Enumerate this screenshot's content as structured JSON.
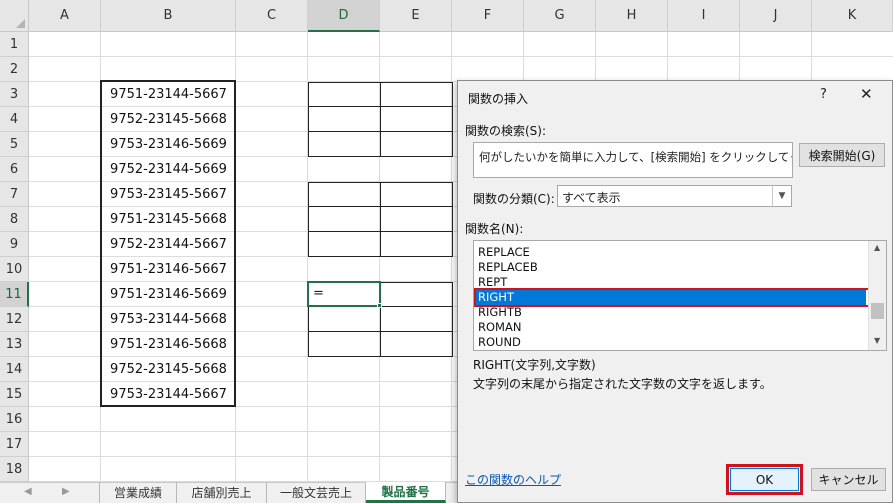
{
  "sheet": {
    "columns": [
      "A",
      "B",
      "C",
      "D",
      "E",
      "F",
      "G",
      "H",
      "I",
      "J",
      "K"
    ],
    "rows": [
      "1",
      "2",
      "3",
      "4",
      "5",
      "6",
      "7",
      "8",
      "9",
      "10",
      "11",
      "12",
      "13",
      "14",
      "15",
      "16",
      "17",
      "18"
    ],
    "selected_column": "D",
    "selected_row": "11",
    "b_values": [
      "9751-23144-5667",
      "9752-23145-5668",
      "9753-23146-5669",
      "9752-23144-5669",
      "9753-23145-5667",
      "9751-23145-5668",
      "9752-23144-5667",
      "9751-23146-5667",
      "9751-23146-5669",
      "9753-23144-5668",
      "9751-23146-5668",
      "9752-23145-5668",
      "9753-23144-5667"
    ],
    "active_cell_text": "=",
    "tabs": [
      "営業成績",
      "店舗別売上",
      "一般文芸売上",
      "製品番号"
    ],
    "active_tab": "製品番号"
  },
  "dialog": {
    "title": "関数の挿入",
    "help_glyph": "?",
    "close_glyph": "✕",
    "search_label": "関数の検索(S):",
    "search_value": "何がしたいかを簡単に入力して、[検索開始] をクリックしてください。",
    "search_button": "検索開始(G)",
    "category_label": "関数の分類(C):",
    "category_value": "すべて表示",
    "names_label": "関数名(N):",
    "functions": [
      "REPLACE",
      "REPLACEB",
      "REPT",
      "RIGHT",
      "RIGHTB",
      "ROMAN",
      "ROUND"
    ],
    "selected_function": "RIGHT",
    "syntax": "RIGHT(文字列,文字数)",
    "description": "文字列の末尾から指定された文字数の文字を返します。",
    "help_link": "この関数のヘルプ",
    "ok_button": "OK",
    "cancel_button": "キャンセル",
    "highlight_color": "#d0121b",
    "selection_color": "#0078d7"
  }
}
